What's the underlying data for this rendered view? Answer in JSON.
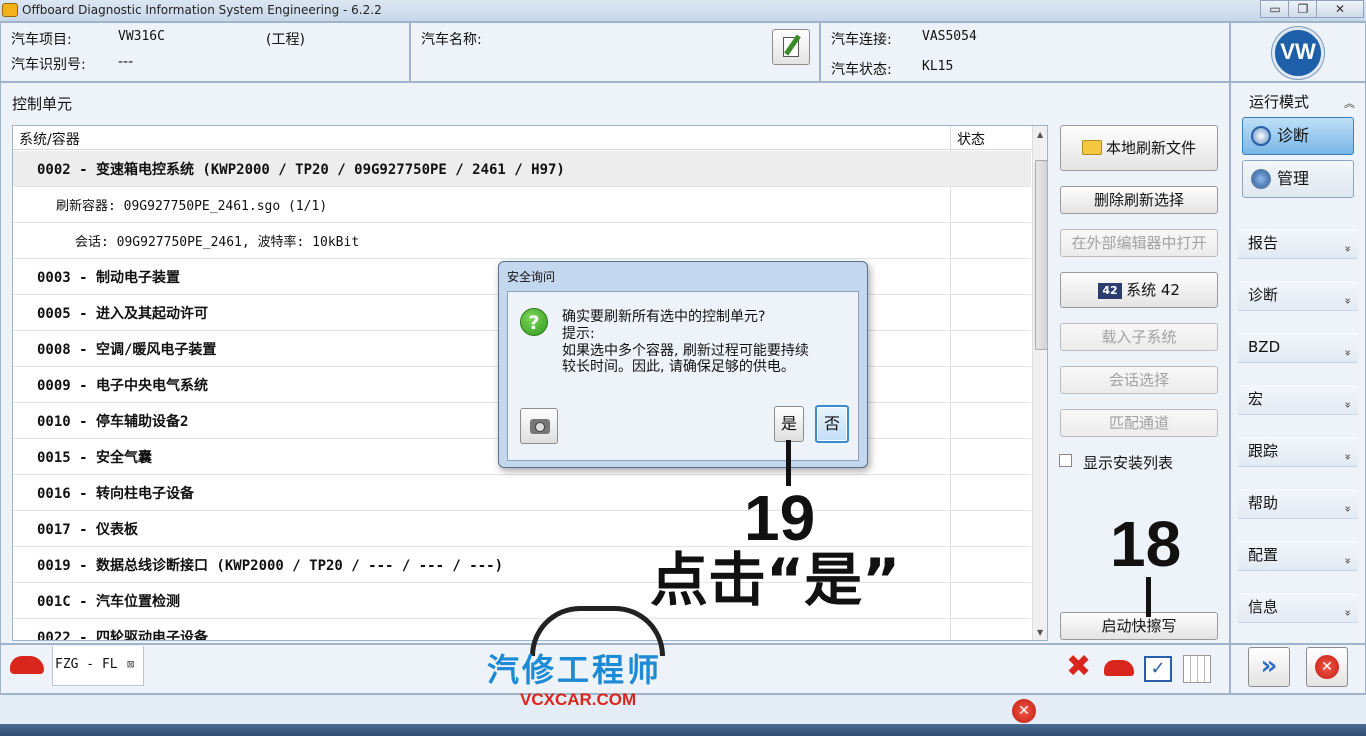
{
  "window": {
    "title": "Offboard Diagnostic Information System Engineering - 6.2.2",
    "minimize": "▭",
    "restore": "❐",
    "close": "✕"
  },
  "header": {
    "project_label": "汽车项目:",
    "project_value": "VW316C",
    "project_note": "(工程)",
    "vin_label": "汽车识别号:",
    "vin_value": "---",
    "car_name_label": "汽车名称:",
    "connection_label": "汽车连接:",
    "connection_value": "VAS5054",
    "status_label": "汽车状态:",
    "status_value": "KL15",
    "logo_text": "VW"
  },
  "main": {
    "section_title": "控制单元",
    "col_system": "系统/容器",
    "col_status": "状态",
    "rows": [
      {
        "text": "0002 - 变速箱电控系统  (KWP2000 / TP20 / 09G927750PE / 2461 / H97)",
        "indent": 0
      },
      {
        "text": "刷新容器: 09G927750PE_2461.sgo (1/1)",
        "indent": 1
      },
      {
        "text": "会话: 09G927750PE_2461, 波特率: 10kBit",
        "indent": 2
      },
      {
        "text": "0003 - 制动电子装置",
        "indent": 0
      },
      {
        "text": "0005 - 进入及其起动许可",
        "indent": 0
      },
      {
        "text": "0008 - 空调/暖风电子装置",
        "indent": 0
      },
      {
        "text": "0009 - 电子中央电气系统",
        "indent": 0
      },
      {
        "text": "0010 - 停车辅助设备2",
        "indent": 0
      },
      {
        "text": "0015 - 安全气囊",
        "indent": 0
      },
      {
        "text": "0016 - 转向柱电子设备",
        "indent": 0
      },
      {
        "text": "0017 - 仪表板",
        "indent": 0
      },
      {
        "text": "0019 - 数据总线诊断接口  (KWP2000 / TP20 / --- / --- / ---)",
        "indent": 0
      },
      {
        "text": "001C - 汽车位置检测",
        "indent": 0
      },
      {
        "text": "0022 - 四轮驱动电子设备",
        "indent": 0
      }
    ]
  },
  "commands": {
    "local_flash_files": "本地刷新文件",
    "delete_flash_selection": "删除刷新选择",
    "open_in_external_editor": "在外部编辑器中打开",
    "system_icon_text": "42",
    "system_label": "系统 42",
    "load_subsystem": "载入子系统",
    "session_select": "会话选择",
    "match_channel": "匹配通道",
    "show_install_list": "显示安装列表",
    "start_fast_flash": "启动快擦写"
  },
  "sidebar": {
    "mode_title": "运行模式",
    "diagnosis": "诊断",
    "manage": "管理",
    "items": [
      "报告",
      "诊断",
      "BZD",
      "宏",
      "跟踪",
      "帮助",
      "配置",
      "信息"
    ],
    "chevron": "»"
  },
  "bottom": {
    "tab_label": "FZG - FL",
    "tab_close": "⊠"
  },
  "dialog": {
    "title": "安全询问",
    "question": "确实要刷新所有选中的控制单元?",
    "hint": "提示:",
    "line1": "如果选中多个容器, 刷新过程可能要持续",
    "line2": "较长时间。因此, 请确保足够的供电。",
    "yes": "是",
    "no": "否"
  },
  "annotations": {
    "step19": "19",
    "step18": "18",
    "instruction": "点击“是”"
  },
  "watermark": {
    "cn": "汽修工程师",
    "en": "VCXCAR.COM"
  },
  "colors": {
    "accent": "#3c8ad0",
    "error_red": "#d9261c",
    "watermark_blue": "#1d8ad6"
  }
}
